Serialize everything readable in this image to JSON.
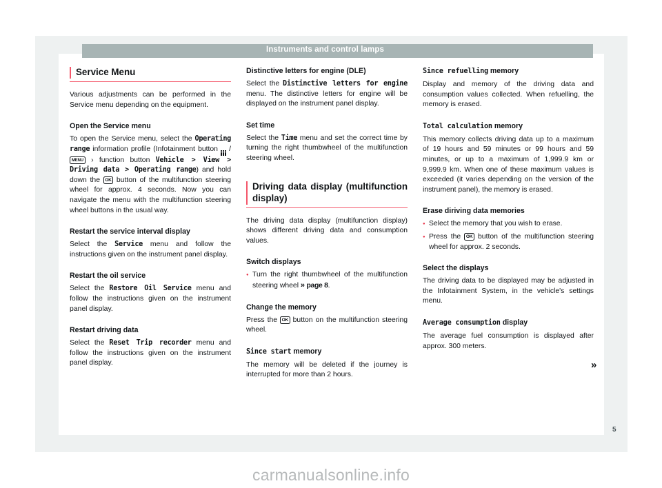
{
  "header": {
    "title": "Instruments and control lamps"
  },
  "footer": {
    "page_number": "5",
    "watermark": "carmanualsonline.info",
    "continue_marker": "»"
  },
  "colors": {
    "accent_red": "#f4566a",
    "bullet_red": "#e8344a",
    "header_band": "#a7b4b4",
    "page_gray": "#eef1f1"
  },
  "col1": {
    "section_title": "Service Menu",
    "intro": "Various adjustments can be performed in the Service menu depending on the equipment.",
    "sub1": {
      "title": "Open the Service menu",
      "t1": "To open the Service menu, select the ",
      "mono1": "Operating range",
      "t2": " information profile (Infotainment button ",
      "icon_grid": "grid-icon",
      "t3": " / ",
      "icon_menu": "MENU",
      "t4": " › function button ",
      "mono2": "Vehicle > View > Driving data > Operating range",
      "t5": ") and hold down the ",
      "icon_ok": "OK",
      "t6": " button of the multifunction steering wheel for approx. 4 seconds. Now you can navigate the menu with the multifunction steering wheel buttons in the usual way."
    },
    "sub2": {
      "title": "Restart the service interval display",
      "t1": "Select the ",
      "mono1": "Service",
      "t2": " menu and follow the instructions given on the instrument panel display."
    },
    "sub3": {
      "title": "Restart the oil service",
      "t1": "Select the ",
      "mono1": "Restore Oil Service",
      "t2": " menu and follow the instructions given on the instrument panel display."
    },
    "sub4": {
      "title": "Restart driving data",
      "t1": "Select the ",
      "mono1": "Reset Trip recorder",
      "t2": " menu and follow the instructions given on the instrument panel display."
    }
  },
  "col2": {
    "sub1": {
      "title": "Distinctive letters for engine (DLE)",
      "t1": "Select the ",
      "mono1": "Distinctive letters for engine",
      "t2": " menu. The distinctive letters for engine will be displayed on the instrument panel display."
    },
    "sub2": {
      "title": "Set time",
      "t1": "Select the ",
      "mono1": "Time",
      "t2": " menu and set the correct time by turning the right thumbwheel of the multifunction steering wheel."
    },
    "section_title": "Driving data display (multifunction display)",
    "intro": "The driving data display (multifunction display) shows different driving data and consumption values.",
    "sub3": {
      "title": "Switch displays",
      "bullet1_a": "Turn the right thumbwheel of the multifunction steering wheel ",
      "bullet1_ref": "page 8",
      "bullet1_b": "."
    },
    "sub4": {
      "title": "Change the memory",
      "t1": "Press the ",
      "icon_ok": "OK",
      "t2": " button on the multifunction steering wheel."
    },
    "sub5": {
      "title_mono": "Since start",
      "title_reg": " memory",
      "t1": "The memory will be deleted if the journey is interrupted for more than 2 hours."
    }
  },
  "col3": {
    "sub1": {
      "title_mono": "Since refuelling",
      "title_reg": " memory",
      "t1": "Display and memory of the driving data and consumption values collected. When refuelling, the memory is erased."
    },
    "sub2": {
      "title_mono": "Total calculation",
      "title_reg": " memory",
      "t1": "This memory collects driving data up to a maximum of 19 hours and 59 minutes or 99 hours and 59 minutes, or up to a maximum of 1,999.9 km or 9,999.9 km. When one of these maximum values is exceeded (it varies depending on the version of the instrument panel), the memory is erased."
    },
    "sub3": {
      "title": "Erase diriving data memories",
      "bullet1": "Select the memory that you wish to erase.",
      "bullet2_a": "Press the ",
      "bullet2_icon": "OK",
      "bullet2_b": " button of the multifunction steering wheel for approx. 2 seconds."
    },
    "sub4": {
      "title": "Select the displays",
      "t1": "The driving data to be displayed may be adjusted in the Infotainment System, in the vehicle's settings menu."
    },
    "sub5": {
      "title_mono": "Average consumption",
      "title_reg": " display",
      "t1": "The average fuel consumption is displayed after approx. 300 meters."
    }
  }
}
